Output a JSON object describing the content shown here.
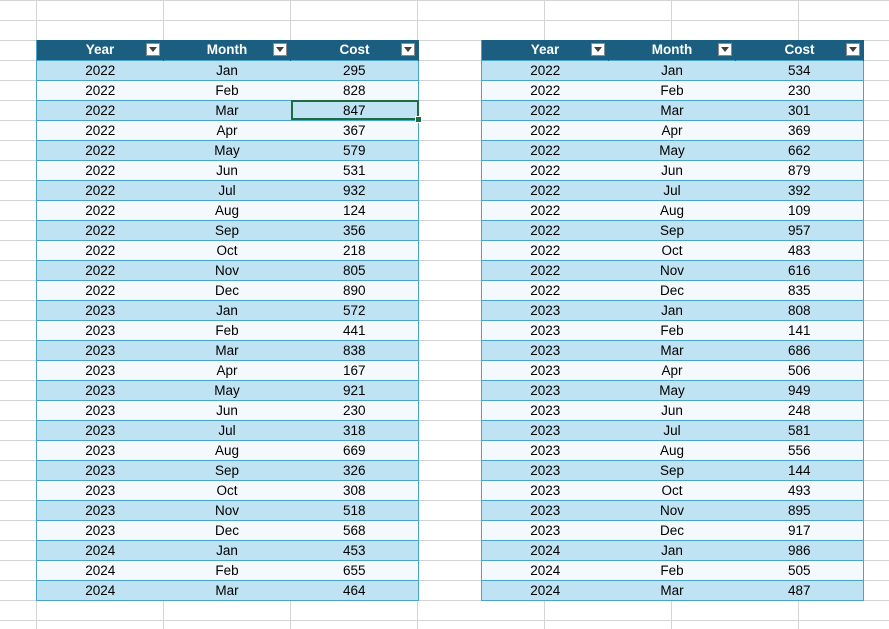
{
  "tables": [
    {
      "headers": [
        "Year",
        "Month",
        "Cost"
      ],
      "rows": [
        [
          "2022",
          "Jan",
          "295"
        ],
        [
          "2022",
          "Feb",
          "828"
        ],
        [
          "2022",
          "Mar",
          "847"
        ],
        [
          "2022",
          "Apr",
          "367"
        ],
        [
          "2022",
          "May",
          "579"
        ],
        [
          "2022",
          "Jun",
          "531"
        ],
        [
          "2022",
          "Jul",
          "932"
        ],
        [
          "2022",
          "Aug",
          "124"
        ],
        [
          "2022",
          "Sep",
          "356"
        ],
        [
          "2022",
          "Oct",
          "218"
        ],
        [
          "2022",
          "Nov",
          "805"
        ],
        [
          "2022",
          "Dec",
          "890"
        ],
        [
          "2023",
          "Jan",
          "572"
        ],
        [
          "2023",
          "Feb",
          "441"
        ],
        [
          "2023",
          "Mar",
          "838"
        ],
        [
          "2023",
          "Apr",
          "167"
        ],
        [
          "2023",
          "May",
          "921"
        ],
        [
          "2023",
          "Jun",
          "230"
        ],
        [
          "2023",
          "Jul",
          "318"
        ],
        [
          "2023",
          "Aug",
          "669"
        ],
        [
          "2023",
          "Sep",
          "326"
        ],
        [
          "2023",
          "Oct",
          "308"
        ],
        [
          "2023",
          "Nov",
          "518"
        ],
        [
          "2023",
          "Dec",
          "568"
        ],
        [
          "2024",
          "Jan",
          "453"
        ],
        [
          "2024",
          "Feb",
          "655"
        ],
        [
          "2024",
          "Mar",
          "464"
        ]
      ]
    },
    {
      "headers": [
        "Year",
        "Month",
        "Cost"
      ],
      "rows": [
        [
          "2022",
          "Jan",
          "534"
        ],
        [
          "2022",
          "Feb",
          "230"
        ],
        [
          "2022",
          "Mar",
          "301"
        ],
        [
          "2022",
          "Apr",
          "369"
        ],
        [
          "2022",
          "May",
          "662"
        ],
        [
          "2022",
          "Jun",
          "879"
        ],
        [
          "2022",
          "Jul",
          "392"
        ],
        [
          "2022",
          "Aug",
          "109"
        ],
        [
          "2022",
          "Sep",
          "957"
        ],
        [
          "2022",
          "Oct",
          "483"
        ],
        [
          "2022",
          "Nov",
          "616"
        ],
        [
          "2022",
          "Dec",
          "835"
        ],
        [
          "2023",
          "Jan",
          "808"
        ],
        [
          "2023",
          "Feb",
          "141"
        ],
        [
          "2023",
          "Mar",
          "686"
        ],
        [
          "2023",
          "Apr",
          "506"
        ],
        [
          "2023",
          "May",
          "949"
        ],
        [
          "2023",
          "Jun",
          "248"
        ],
        [
          "2023",
          "Jul",
          "581"
        ],
        [
          "2023",
          "Aug",
          "556"
        ],
        [
          "2023",
          "Sep",
          "144"
        ],
        [
          "2023",
          "Oct",
          "493"
        ],
        [
          "2023",
          "Nov",
          "895"
        ],
        [
          "2023",
          "Dec",
          "917"
        ],
        [
          "2024",
          "Jan",
          "986"
        ],
        [
          "2024",
          "Feb",
          "505"
        ],
        [
          "2024",
          "Mar",
          "487"
        ]
      ]
    }
  ],
  "selected_cell": {
    "table": 0,
    "row": 2,
    "col": 2
  },
  "colors": {
    "header_bg": "#1b5e80",
    "band_bg": "#bfe3f3",
    "plain_bg": "#f4f9fd",
    "row_border": "#4aa3c9",
    "selection": "#1e6c41"
  },
  "icons": {
    "filter": "filter-dropdown-icon"
  }
}
